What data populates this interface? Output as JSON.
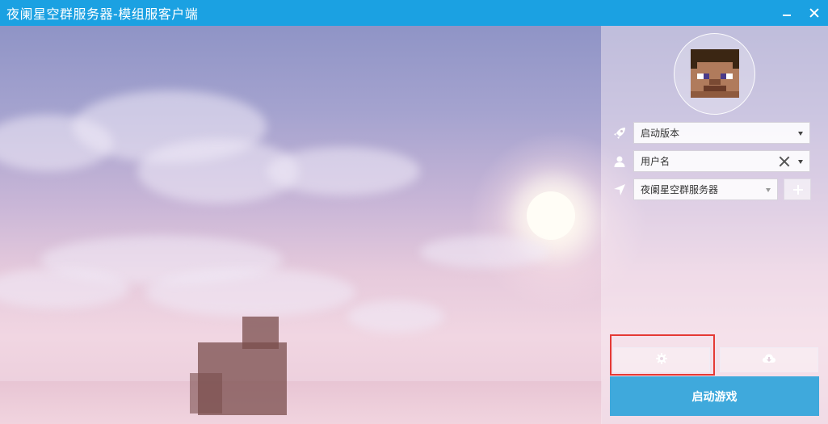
{
  "window": {
    "title": "夜阑星空群服务器-模组服客户端",
    "minimize_icon": "minimize-icon",
    "close_icon": "close-icon"
  },
  "colors": {
    "titlebar": "#1ba1e2",
    "launch_button": "#3fa9dc",
    "highlight": "#e53935"
  },
  "login": {
    "avatar": "steve-avatar",
    "version": {
      "icon": "rocket-icon",
      "label": "启动版本"
    },
    "username": {
      "icon": "user-icon",
      "label": "用户名"
    },
    "server": {
      "icon": "location-arrow-icon",
      "label": "夜阑星空群服务器"
    },
    "add_server_icon": "plus-icon"
  },
  "actions": {
    "settings_icon": "gear-icon",
    "download_icon": "cloud-download-icon",
    "launch_label": "启动游戏"
  }
}
